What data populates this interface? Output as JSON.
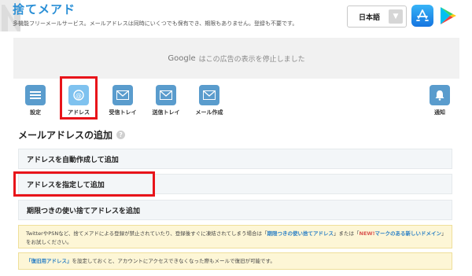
{
  "header": {
    "title": "捨てメアド",
    "tagline": "多機能フリーメールサービス。メールアドレスは同時にいくつでも保有でき、期限もありません。登録も不要です。"
  },
  "language": {
    "selected": "日本語"
  },
  "stores": {
    "appstore_icon": "app-store-icon",
    "playstore_icon": "google-play-icon"
  },
  "ad": {
    "google": "Google",
    "message": "はこの広告の表示を停止しました"
  },
  "toolbar": {
    "items": [
      {
        "label": "設定",
        "icon": "menu-icon"
      },
      {
        "label": "アドレス",
        "icon": "address-icon"
      },
      {
        "label": "受信トレイ",
        "icon": "mail-icon"
      },
      {
        "label": "送信トレイ",
        "icon": "mail-icon"
      },
      {
        "label": "メール作成",
        "icon": "mail-icon"
      },
      {
        "label": "通知",
        "icon": "bell-icon"
      }
    ],
    "active": "アドレス"
  },
  "section": {
    "heading": "メールアドレスの追加",
    "help_icon": "?"
  },
  "options": [
    "アドレスを自動作成して追加",
    "アドレスを指定して追加",
    "期限つきの使い捨てアドレスを追加"
  ],
  "notices": {
    "first": {
      "text_a": "TwitterやPSNなど、捨てメアドによる登録が禁止されていたり、登録後すぐに凍結されてしまう場合は「",
      "link_a": "期限つきの使い捨てアドレス",
      "text_b": "」または「",
      "new_tag": "NEW!",
      "link_b": "マークのある新しいドメイン",
      "text_c": "」をお試しください。"
    },
    "second": {
      "link": "「復旧用アドレス」",
      "text_a": "を設定しておくと、アカウントにアクセスできなくなった際もメールで復旧が可能です。"
    }
  },
  "colors": {
    "brand": "#2a8fd6",
    "highlight": "#e8141a",
    "notice_bg": "#fdf6d6",
    "icon_blue": "#5a9ccd"
  }
}
